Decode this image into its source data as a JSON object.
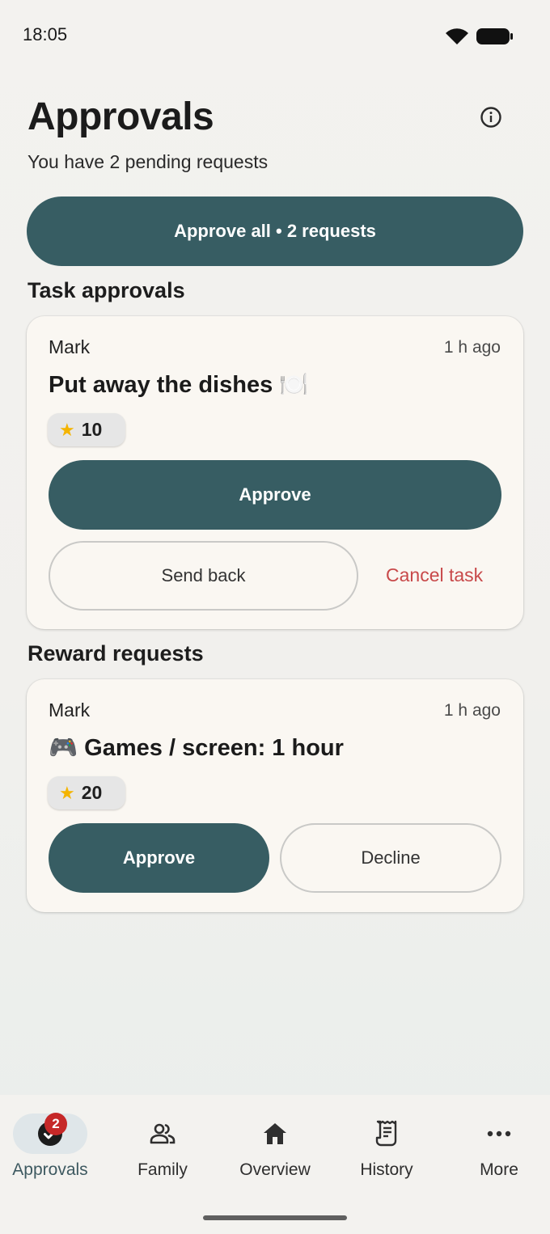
{
  "status_bar": {
    "time": "18:05"
  },
  "header": {
    "title": "Approvals",
    "subtitle": "You have 2 pending requests",
    "info_icon": "info-icon"
  },
  "approve_all": {
    "label": "Approve all • 2 requests"
  },
  "task_section": {
    "title": "Task approvals",
    "cards": [
      {
        "user": "Mark",
        "time": "1 h ago",
        "title": "Put away the dishes 🍽️",
        "points": "10",
        "approve_label": "Approve",
        "send_back_label": "Send back",
        "cancel_label": "Cancel task"
      }
    ]
  },
  "reward_section": {
    "title": "Reward requests",
    "cards": [
      {
        "user": "Mark",
        "time": "1 h ago",
        "title": "🎮 Games / screen: 1 hour",
        "points": "20",
        "approve_label": "Approve",
        "decline_label": "Decline"
      }
    ]
  },
  "bottom_nav": {
    "items": [
      {
        "label": "Approvals",
        "icon": "check-circle-icon",
        "badge": "2",
        "active": true
      },
      {
        "label": "Family",
        "icon": "people-icon",
        "active": false
      },
      {
        "label": "Overview",
        "icon": "home-icon",
        "active": false
      },
      {
        "label": "History",
        "icon": "receipt-icon",
        "active": false
      },
      {
        "label": "More",
        "icon": "more-horizontal-icon",
        "active": false
      }
    ]
  },
  "colors": {
    "primary": "#375d63",
    "danger": "#c8494a",
    "badge": "#c62828",
    "card": "#faf7f2"
  }
}
